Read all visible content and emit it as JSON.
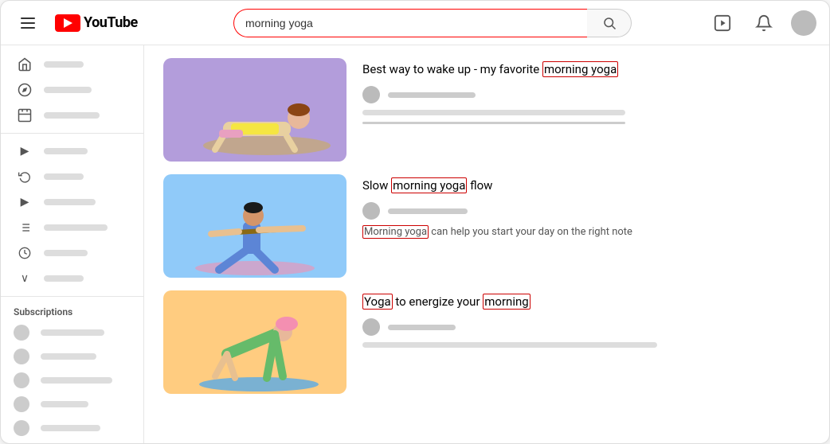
{
  "header": {
    "menu_icon": "☰",
    "logo_text": "YouTube",
    "search_value": "morning yoga",
    "search_placeholder": "Search",
    "upload_icon": "upload",
    "bell_icon": "bell",
    "avatar_alt": "User avatar"
  },
  "sidebar": {
    "main_items": [
      {
        "icon": "🏠",
        "label_width": 50
      },
      {
        "icon": "🔭",
        "label_width": 60
      },
      {
        "icon": "📦",
        "label_width": 70
      }
    ],
    "secondary_items": [
      {
        "icon": "▶",
        "label_width": 55
      },
      {
        "icon": "🕐",
        "label_width": 50
      },
      {
        "icon": "▶",
        "label_width": 65
      },
      {
        "icon": "⠿",
        "label_width": 80
      },
      {
        "icon": "🕐",
        "label_width": 55
      },
      {
        "icon": "∨",
        "label_width": 50
      }
    ],
    "subscriptions_title": "Subscriptions",
    "subscriptions": [
      {
        "label_width": 80
      },
      {
        "label_width": 70
      },
      {
        "label_width": 90
      },
      {
        "label_width": 60
      },
      {
        "label_width": 75
      }
    ]
  },
  "videos": [
    {
      "id": 1,
      "title_before": "Best way to wake up - my favorite ",
      "title_highlight": "morning yoga",
      "title_after": "",
      "has_desc": false,
      "has_desc_text": false,
      "desc_highlight": "",
      "desc_before": "",
      "desc_after": "",
      "thumbnail_class": "thumbnail-1",
      "meta_bar_width": 110,
      "desc_bar_width": 330
    },
    {
      "id": 2,
      "title_before": "Slow ",
      "title_highlight": "morning yoga",
      "title_after": " flow",
      "has_desc_text": true,
      "desc_highlight_prefix": "",
      "desc_text_part1": "Morning yoga",
      "desc_text_part2": " can help you start your day on the right note",
      "thumbnail_class": "thumbnail-2",
      "meta_bar_width": 100,
      "desc_bar_width": 0
    },
    {
      "id": 3,
      "title_before": "",
      "title_highlight": "Yoga",
      "title_after": " to energize your ",
      "title_highlight2": "morning",
      "thumbnail_class": "thumbnail-3",
      "has_desc_text": false,
      "meta_bar_width": 85,
      "desc_bar_width": 370
    }
  ]
}
